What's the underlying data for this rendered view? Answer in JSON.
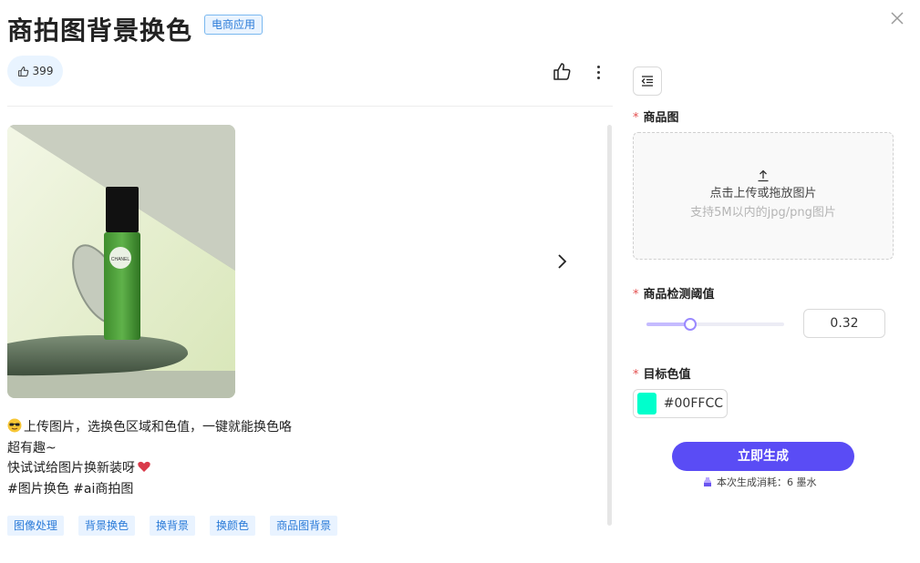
{
  "header": {
    "title": "商拍图背景换色",
    "badge": "电商应用"
  },
  "actions": {
    "like_count": "399",
    "like_icon": "thumbs-up-icon",
    "more_icon": "more-vertical-icon",
    "close_icon": "close-icon"
  },
  "gallery": {
    "next_icon": "chevron-right-icon",
    "bottle_label": "CHANEL"
  },
  "description": {
    "line1": "上传图片，选换色区域和色值，一键就能换色咯",
    "line2": "超有趣~",
    "line3": "快试试给图片换新装呀",
    "line4": "#图片换色 #ai商拍图"
  },
  "tags": [
    "图像处理",
    "背景换色",
    "换背景",
    "换颜色",
    "商品图背景"
  ],
  "form": {
    "required_mark": "*",
    "product_image": {
      "label": "商品图",
      "upload_text": "点击上传或拖放图片",
      "upload_hint": "支持5M以内的jpg/png图片"
    },
    "threshold": {
      "label": "商品检测阈值",
      "value": "0.32",
      "fraction": 0.32
    },
    "target_color": {
      "label": "目标色值",
      "value": "#00FFCC",
      "swatch": "#00FFCC"
    },
    "generate_button": "立即生成",
    "cost_text": "本次生成消耗：6 墨水"
  },
  "colors": {
    "accent": "#5a4cf5",
    "tag_bg": "#e9f3ff",
    "tag_text": "#2b7bd8",
    "required": "#e34d4d"
  }
}
